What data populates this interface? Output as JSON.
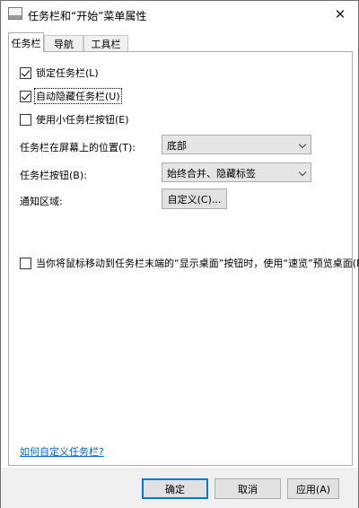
{
  "window": {
    "title": "任务栏和“开始”菜单属性",
    "close_glyph": "✕"
  },
  "tabs": [
    {
      "label": "任务栏",
      "selected": true
    },
    {
      "label": "导航",
      "selected": false
    },
    {
      "label": "工具栏",
      "selected": false
    }
  ],
  "options": {
    "lock_taskbar": {
      "label": "锁定任务栏(L)",
      "checked": true
    },
    "auto_hide": {
      "label": "自动隐藏任务栏(U)",
      "checked": true
    },
    "small_buttons": {
      "label": "使用小任务栏按钮(E)",
      "checked": false
    }
  },
  "fields": {
    "position": {
      "label": "任务栏在屏幕上的位置(T):",
      "value": "底部"
    },
    "buttons": {
      "label": "任务栏按钮(B):",
      "value": "始终合并、隐藏标签"
    },
    "notification": {
      "label": "通知区域:",
      "button_label": "自定义(C)..."
    }
  },
  "peek": {
    "label": "当你将鼠标移动到任务栏末端的“显示桌面”按钮时，使用“速览”预览桌面(P)",
    "checked": false
  },
  "help_link": "如何自定义任务栏?",
  "footer": {
    "ok": "确定",
    "cancel": "取消",
    "apply": "应用(A)"
  },
  "colors": {
    "link": "#0066cc",
    "default_button_border": "#0078d7",
    "footer_bg": "#f0f0f0"
  }
}
